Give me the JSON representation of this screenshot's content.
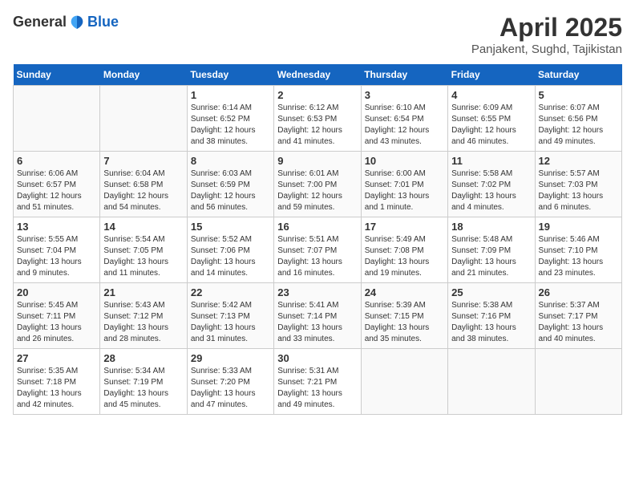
{
  "logo": {
    "general": "General",
    "blue": "Blue"
  },
  "title": "April 2025",
  "subtitle": "Panjakent, Sughd, Tajikistan",
  "days_of_week": [
    "Sunday",
    "Monday",
    "Tuesday",
    "Wednesday",
    "Thursday",
    "Friday",
    "Saturday"
  ],
  "weeks": [
    [
      {
        "day": "",
        "info": ""
      },
      {
        "day": "",
        "info": ""
      },
      {
        "day": "1",
        "info": "Sunrise: 6:14 AM\nSunset: 6:52 PM\nDaylight: 12 hours and 38 minutes."
      },
      {
        "day": "2",
        "info": "Sunrise: 6:12 AM\nSunset: 6:53 PM\nDaylight: 12 hours and 41 minutes."
      },
      {
        "day": "3",
        "info": "Sunrise: 6:10 AM\nSunset: 6:54 PM\nDaylight: 12 hours and 43 minutes."
      },
      {
        "day": "4",
        "info": "Sunrise: 6:09 AM\nSunset: 6:55 PM\nDaylight: 12 hours and 46 minutes."
      },
      {
        "day": "5",
        "info": "Sunrise: 6:07 AM\nSunset: 6:56 PM\nDaylight: 12 hours and 49 minutes."
      }
    ],
    [
      {
        "day": "6",
        "info": "Sunrise: 6:06 AM\nSunset: 6:57 PM\nDaylight: 12 hours and 51 minutes."
      },
      {
        "day": "7",
        "info": "Sunrise: 6:04 AM\nSunset: 6:58 PM\nDaylight: 12 hours and 54 minutes."
      },
      {
        "day": "8",
        "info": "Sunrise: 6:03 AM\nSunset: 6:59 PM\nDaylight: 12 hours and 56 minutes."
      },
      {
        "day": "9",
        "info": "Sunrise: 6:01 AM\nSunset: 7:00 PM\nDaylight: 12 hours and 59 minutes."
      },
      {
        "day": "10",
        "info": "Sunrise: 6:00 AM\nSunset: 7:01 PM\nDaylight: 13 hours and 1 minute."
      },
      {
        "day": "11",
        "info": "Sunrise: 5:58 AM\nSunset: 7:02 PM\nDaylight: 13 hours and 4 minutes."
      },
      {
        "day": "12",
        "info": "Sunrise: 5:57 AM\nSunset: 7:03 PM\nDaylight: 13 hours and 6 minutes."
      }
    ],
    [
      {
        "day": "13",
        "info": "Sunrise: 5:55 AM\nSunset: 7:04 PM\nDaylight: 13 hours and 9 minutes."
      },
      {
        "day": "14",
        "info": "Sunrise: 5:54 AM\nSunset: 7:05 PM\nDaylight: 13 hours and 11 minutes."
      },
      {
        "day": "15",
        "info": "Sunrise: 5:52 AM\nSunset: 7:06 PM\nDaylight: 13 hours and 14 minutes."
      },
      {
        "day": "16",
        "info": "Sunrise: 5:51 AM\nSunset: 7:07 PM\nDaylight: 13 hours and 16 minutes."
      },
      {
        "day": "17",
        "info": "Sunrise: 5:49 AM\nSunset: 7:08 PM\nDaylight: 13 hours and 19 minutes."
      },
      {
        "day": "18",
        "info": "Sunrise: 5:48 AM\nSunset: 7:09 PM\nDaylight: 13 hours and 21 minutes."
      },
      {
        "day": "19",
        "info": "Sunrise: 5:46 AM\nSunset: 7:10 PM\nDaylight: 13 hours and 23 minutes."
      }
    ],
    [
      {
        "day": "20",
        "info": "Sunrise: 5:45 AM\nSunset: 7:11 PM\nDaylight: 13 hours and 26 minutes."
      },
      {
        "day": "21",
        "info": "Sunrise: 5:43 AM\nSunset: 7:12 PM\nDaylight: 13 hours and 28 minutes."
      },
      {
        "day": "22",
        "info": "Sunrise: 5:42 AM\nSunset: 7:13 PM\nDaylight: 13 hours and 31 minutes."
      },
      {
        "day": "23",
        "info": "Sunrise: 5:41 AM\nSunset: 7:14 PM\nDaylight: 13 hours and 33 minutes."
      },
      {
        "day": "24",
        "info": "Sunrise: 5:39 AM\nSunset: 7:15 PM\nDaylight: 13 hours and 35 minutes."
      },
      {
        "day": "25",
        "info": "Sunrise: 5:38 AM\nSunset: 7:16 PM\nDaylight: 13 hours and 38 minutes."
      },
      {
        "day": "26",
        "info": "Sunrise: 5:37 AM\nSunset: 7:17 PM\nDaylight: 13 hours and 40 minutes."
      }
    ],
    [
      {
        "day": "27",
        "info": "Sunrise: 5:35 AM\nSunset: 7:18 PM\nDaylight: 13 hours and 42 minutes."
      },
      {
        "day": "28",
        "info": "Sunrise: 5:34 AM\nSunset: 7:19 PM\nDaylight: 13 hours and 45 minutes."
      },
      {
        "day": "29",
        "info": "Sunrise: 5:33 AM\nSunset: 7:20 PM\nDaylight: 13 hours and 47 minutes."
      },
      {
        "day": "30",
        "info": "Sunrise: 5:31 AM\nSunset: 7:21 PM\nDaylight: 13 hours and 49 minutes."
      },
      {
        "day": "",
        "info": ""
      },
      {
        "day": "",
        "info": ""
      },
      {
        "day": "",
        "info": ""
      }
    ]
  ]
}
